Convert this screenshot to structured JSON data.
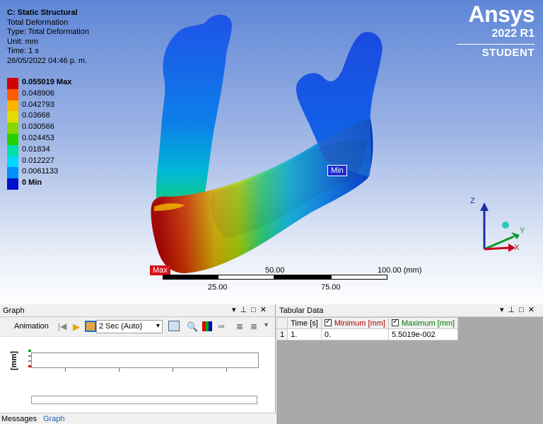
{
  "viewport": {
    "info": {
      "title": "C: Static Structural",
      "result": "Total Deformation",
      "type": "Type: Total Deformation",
      "unit": "Unit: mm",
      "time": "Time: 1 s",
      "date": "26/05/2022 04:46 p. m."
    },
    "legend": {
      "labels": [
        "0.055019 Max",
        "0.048906",
        "0.042793",
        "0.03668",
        "0.030566",
        "0.024453",
        "0.01834",
        "0.012227",
        "0.0061133",
        "0 Min"
      ],
      "colors": [
        "#d10000",
        "#ff5b00",
        "#ffb400",
        "#e2dc00",
        "#86d700",
        "#21d200",
        "#00e0a8",
        "#00d7ff",
        "#008fff",
        "#0010cf"
      ]
    },
    "brand": {
      "name": "Ansys",
      "version": "2022 R1",
      "edition": "STUDENT"
    },
    "probes": {
      "min": "Min",
      "max": "Max"
    },
    "scale": {
      "top_mid": "50.00",
      "top_end": "100.00 (mm)",
      "bot_1": "25.00",
      "bot_2": "75.00"
    },
    "triad": {
      "x": "X",
      "y": "Y",
      "z": "Z"
    }
  },
  "graph": {
    "title": "Graph",
    "animation_label": "Animation",
    "duration_value": "2 Sec (Auto)",
    "y_unit": "[mm]",
    "tabs": [
      "Messages",
      "Graph"
    ]
  },
  "tabular": {
    "title": "Tabular Data",
    "headers": [
      "Time [s]",
      "Minimum [mm]",
      "Maximum [mm]"
    ],
    "rows": [
      {
        "idx": "1",
        "time": "1.",
        "min": "0.",
        "max": "5.5019e-002"
      }
    ]
  },
  "colors": {
    "min_tag": "#1a2dd4",
    "max_tag": "#d8121a",
    "min_header": "#b00000",
    "max_header": "#007a00"
  }
}
